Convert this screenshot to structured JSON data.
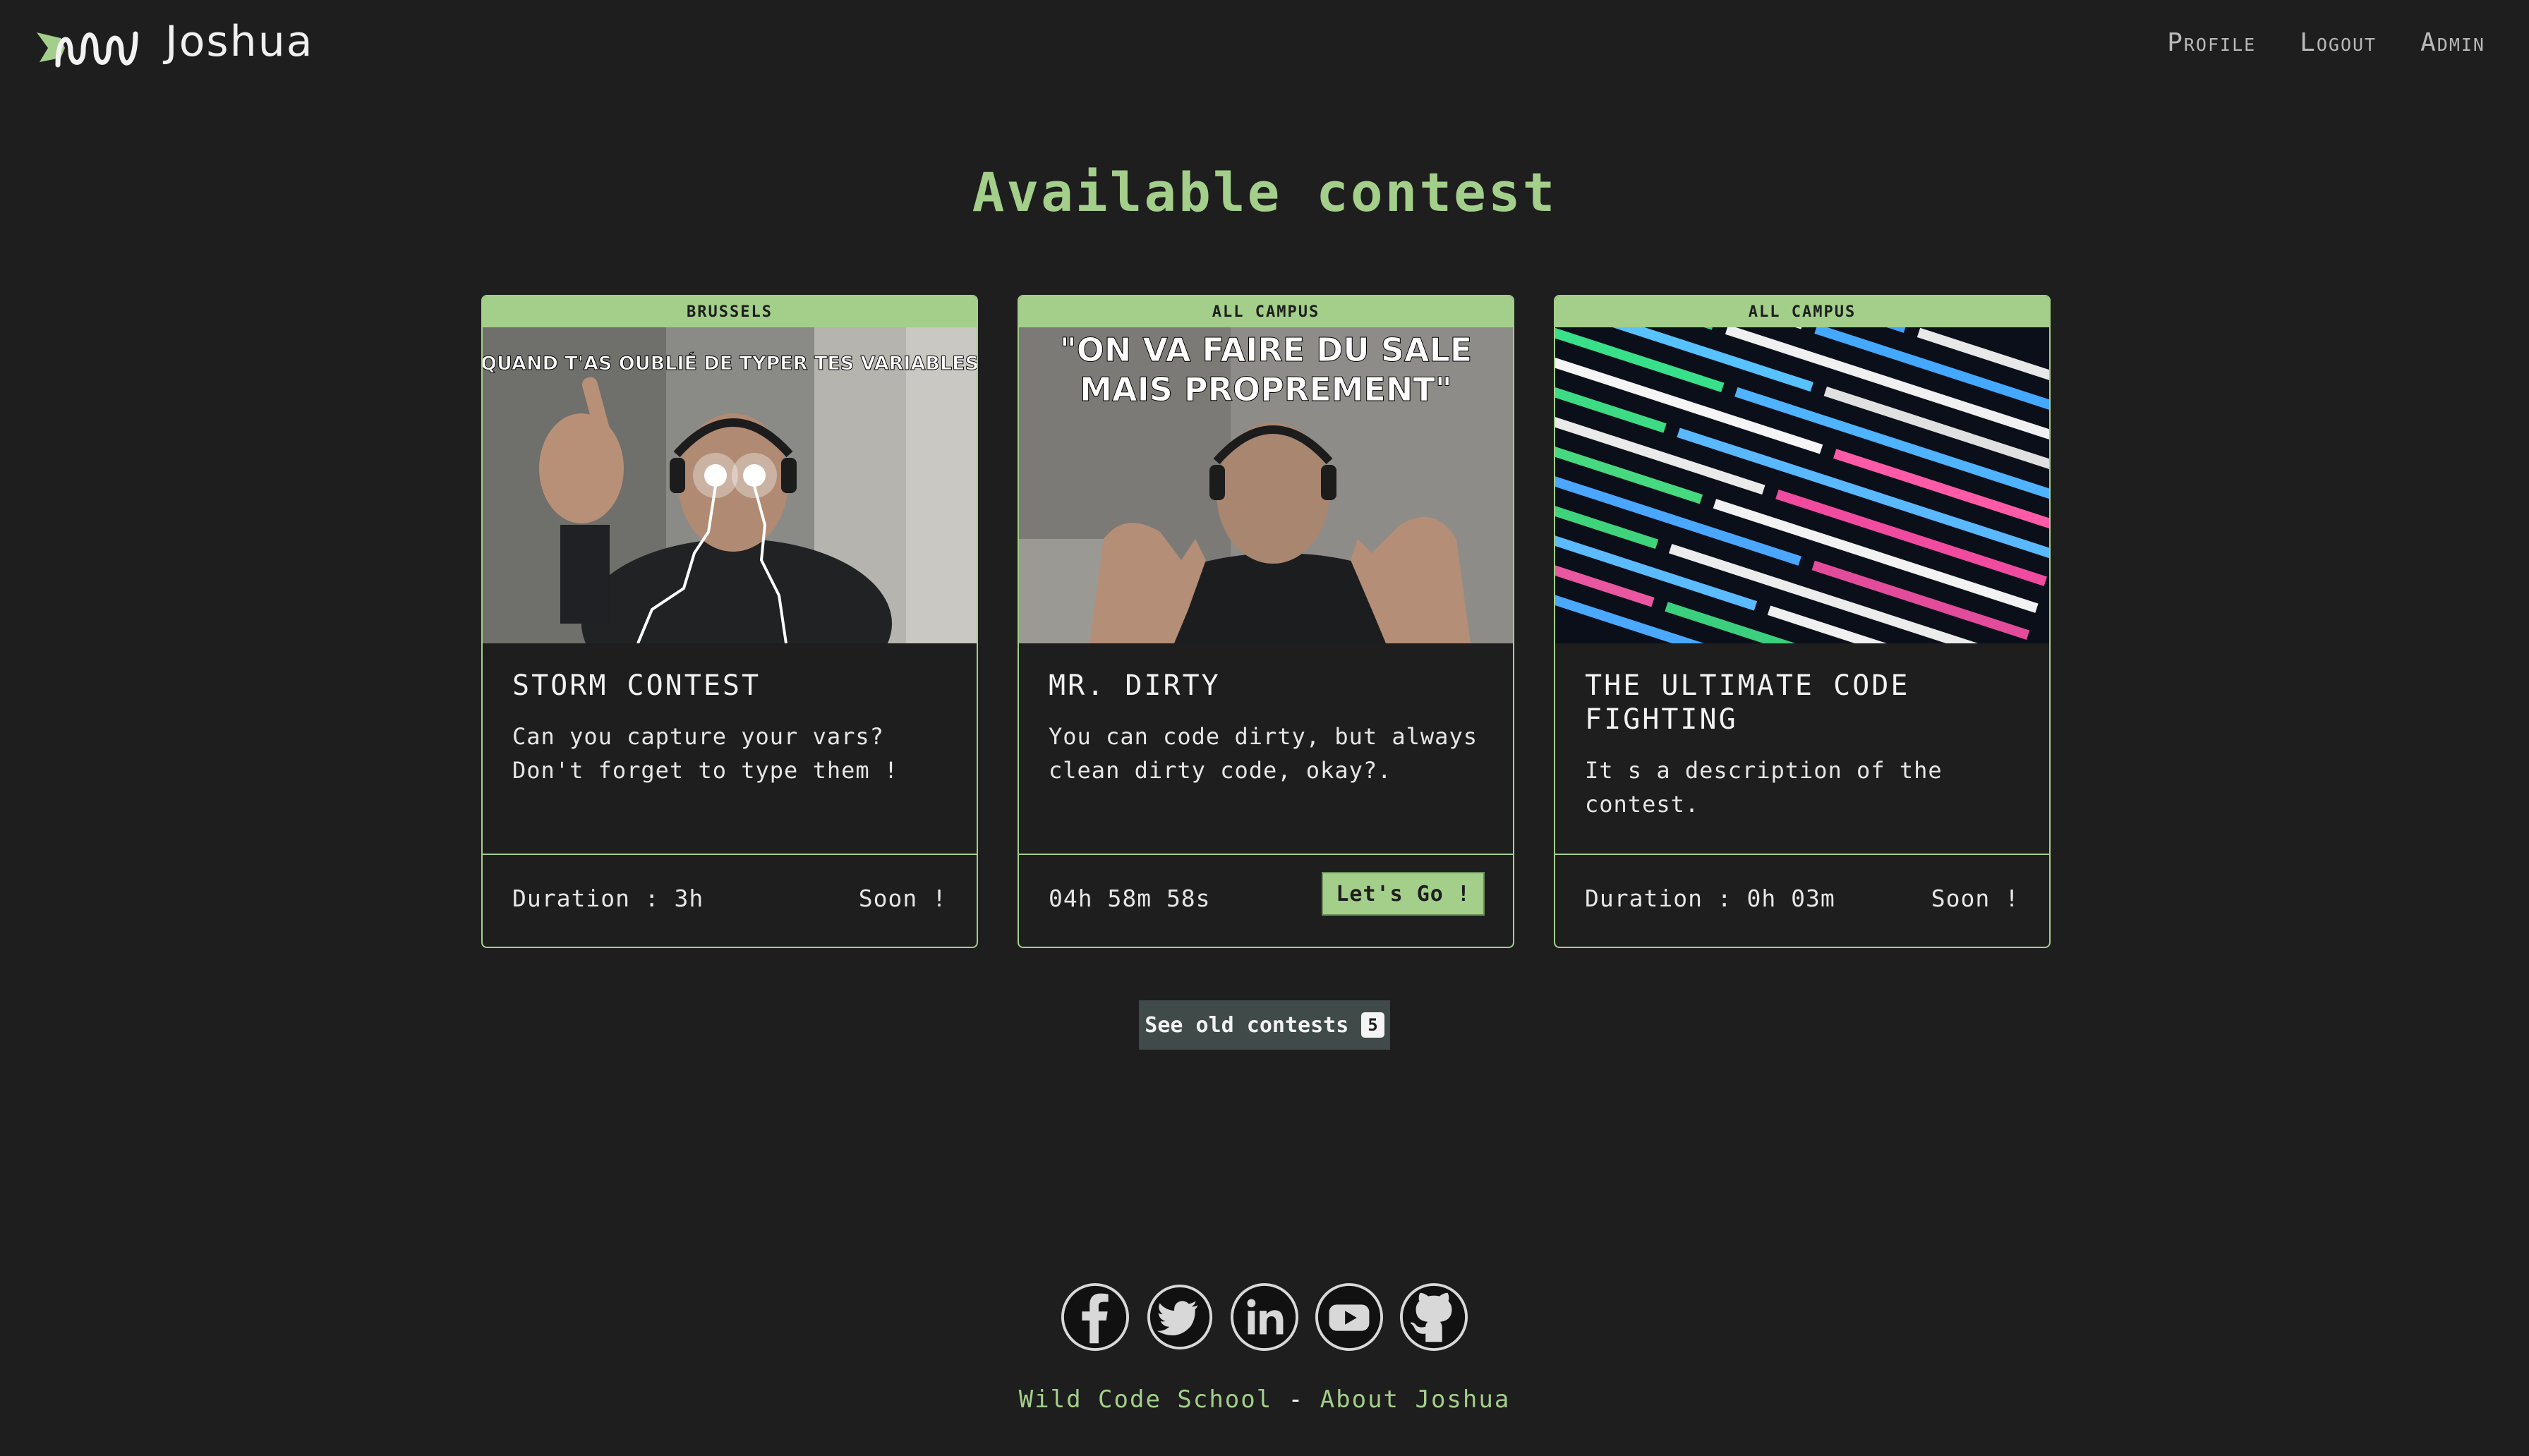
{
  "header": {
    "brand": "Joshua",
    "nav": [
      {
        "label": "Profile"
      },
      {
        "label": "Logout"
      },
      {
        "label": "Admin"
      }
    ]
  },
  "page_title": "Available contest",
  "cards": [
    {
      "tag": "BRUSSELS",
      "image_caption": "QUAND T'AS OUBLIÉ DE TYPER TES VARIABLES",
      "title": "STORM CONTEST",
      "description": "Can you capture your vars? Don't forget to type them !",
      "duration": "Duration : 3h",
      "status": "Soon !"
    },
    {
      "tag": "ALL CAMPUS",
      "image_caption_line1": "\"ON VA FAIRE DU SALE",
      "image_caption_line2": "MAIS PROPREMENT\"",
      "title": "MR. DIRTY",
      "description": "You can code dirty, but always clean dirty code, okay?.",
      "timer": "04h 58m 58s",
      "button": "Let's Go !"
    },
    {
      "tag": "ALL CAMPUS",
      "title": "THE ULTIMATE CODE FIGHTING",
      "description": "It s a description of the contest.",
      "duration": "Duration : 0h 03m",
      "status": "Soon !"
    }
  ],
  "old_contests": {
    "label": "See old contests",
    "count": "5"
  },
  "footer": {
    "socials": [
      "facebook-icon",
      "twitter-icon",
      "linkedin-icon",
      "youtube-icon",
      "github-icon"
    ],
    "school_link": "Wild Code School",
    "separator": "-",
    "about_link": "About Joshua"
  },
  "colors": {
    "background": "#1e1e1e",
    "accent": "#a3cf8a",
    "button_dark": "#3f4a49"
  }
}
